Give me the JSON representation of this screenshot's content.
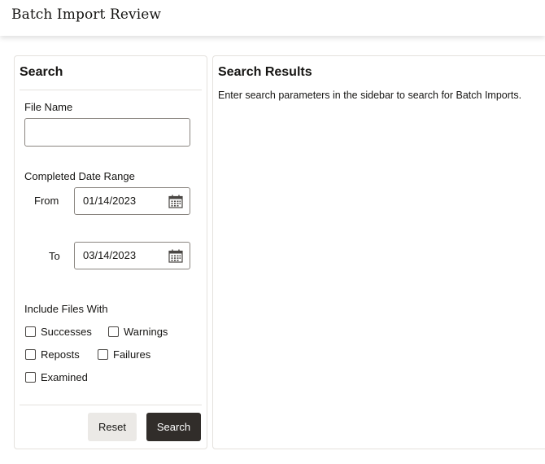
{
  "header": {
    "title": "Batch Import Review"
  },
  "sidebar": {
    "title": "Search",
    "file_name": {
      "label": "File Name",
      "value": "",
      "placeholder": ""
    },
    "date_range": {
      "label": "Completed Date Range",
      "from_label": "From",
      "from_value": "01/14/2023",
      "to_label": "To",
      "to_value": "03/14/2023"
    },
    "include": {
      "label": "Include Files With",
      "options": [
        {
          "label": "Successes",
          "checked": false
        },
        {
          "label": "Warnings",
          "checked": false
        },
        {
          "label": "Reposts",
          "checked": false
        },
        {
          "label": "Failures",
          "checked": false
        },
        {
          "label": "Examined",
          "checked": false
        }
      ]
    },
    "buttons": {
      "reset": "Reset",
      "search": "Search"
    }
  },
  "results": {
    "title": "Search Results",
    "hint": "Enter search parameters in the sidebar to search for Batch Imports."
  },
  "colors": {
    "primary_button": "#312d2a",
    "secondary_button": "#ebe9e6",
    "border": "#e4e1dd",
    "text": "#161513"
  }
}
